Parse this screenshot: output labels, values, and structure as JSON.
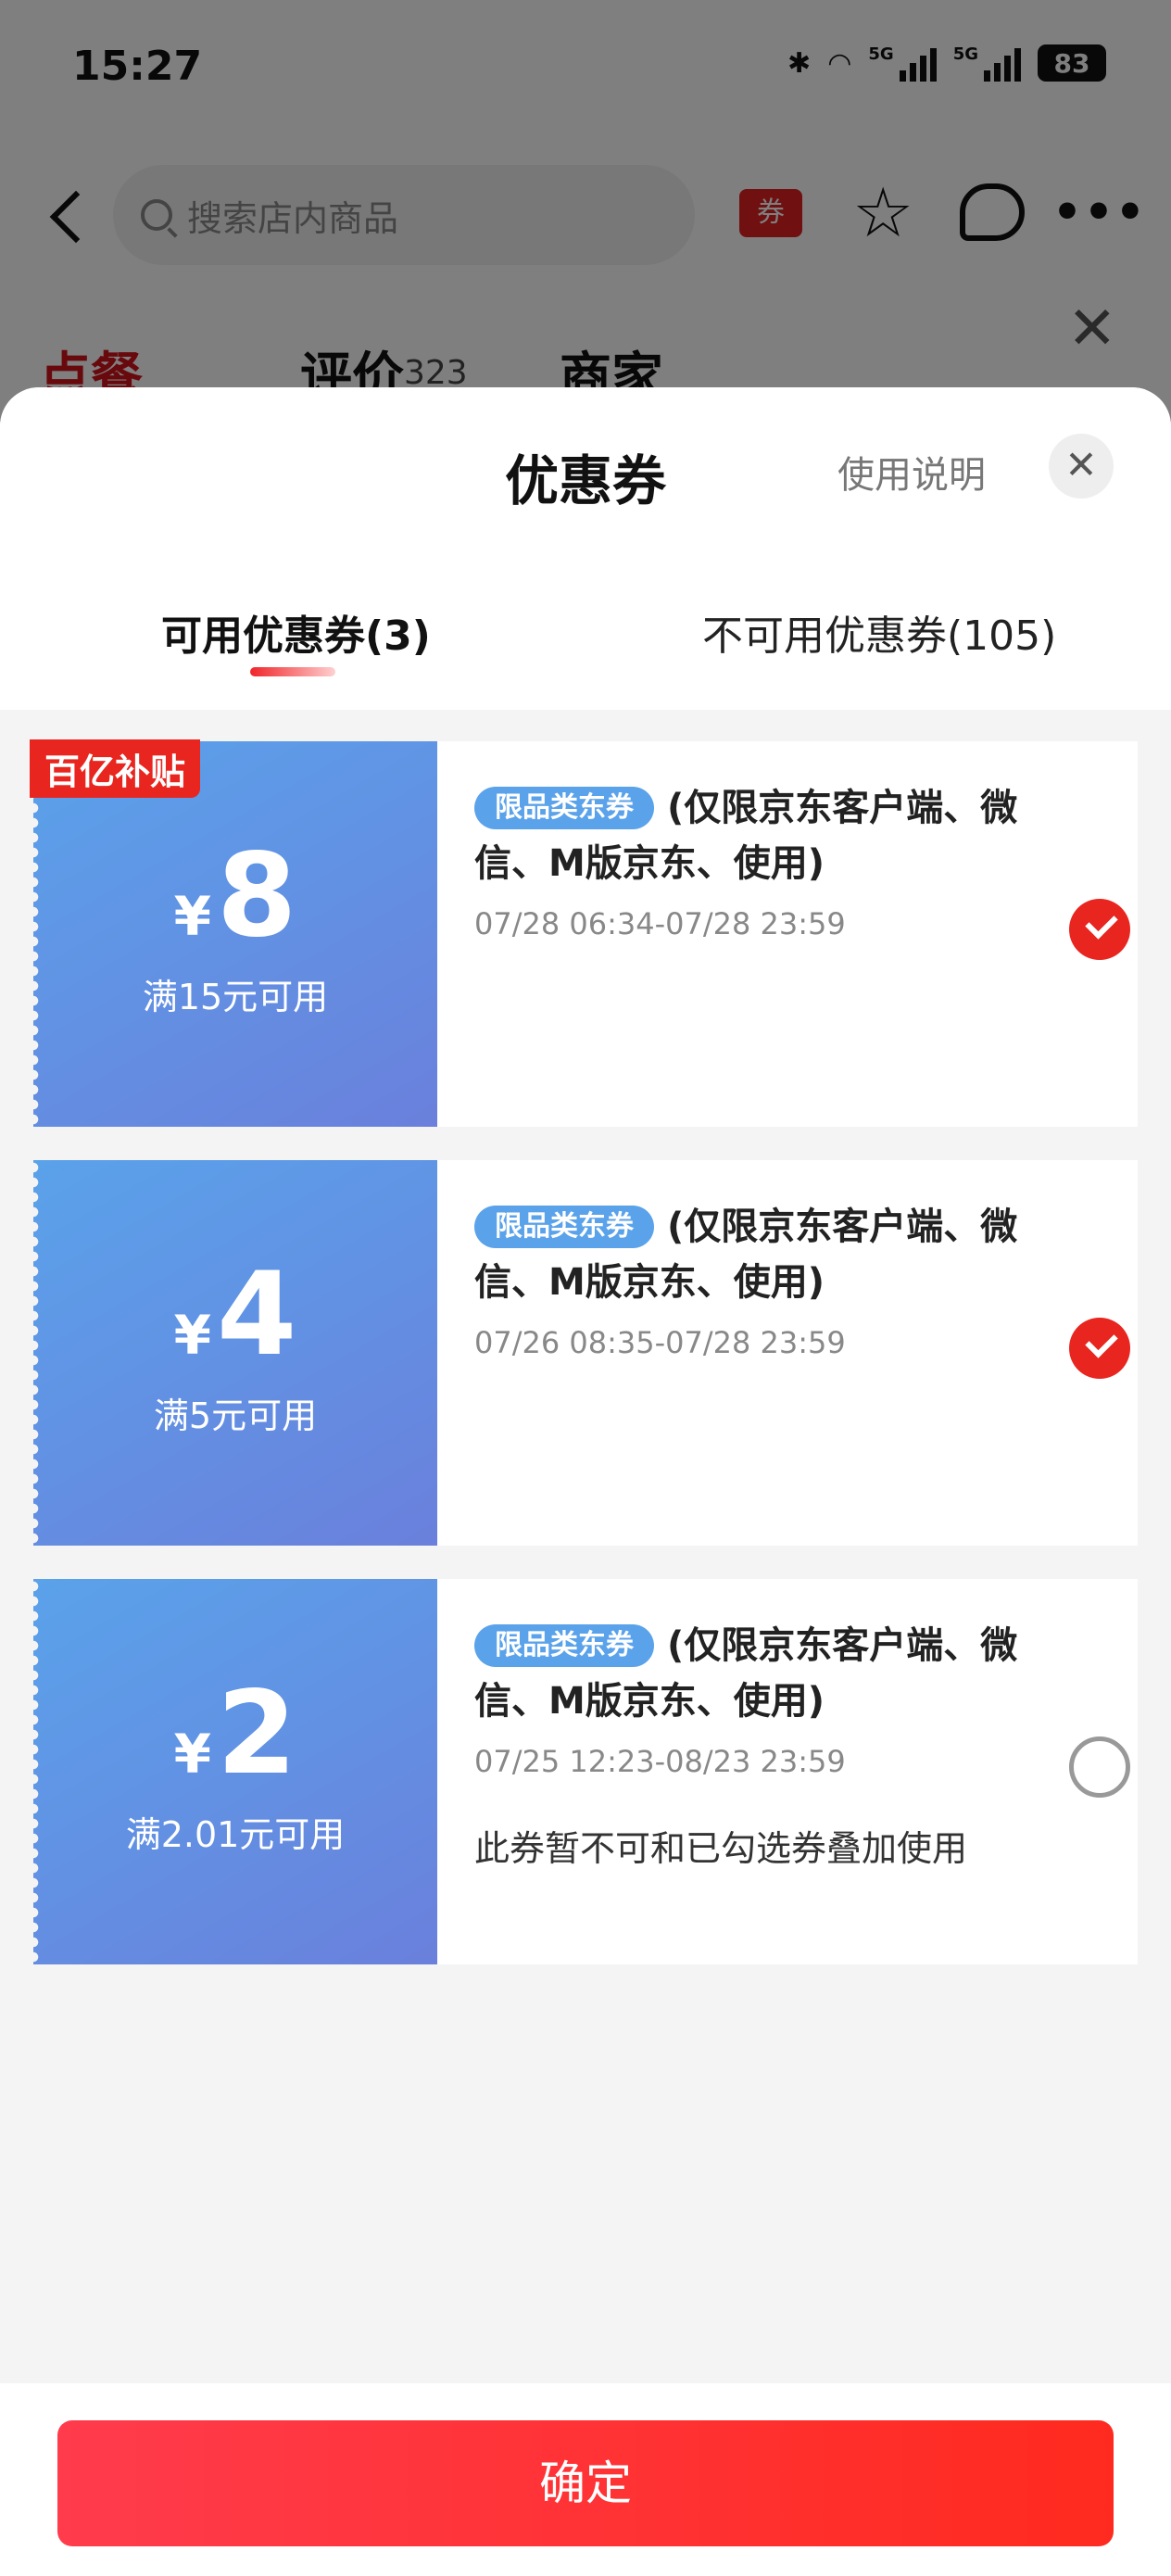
{
  "status": {
    "time": "15:27",
    "signal1": "5G",
    "signal2": "5G",
    "battery": "83"
  },
  "nav": {
    "search_placeholder": "搜索店内商品",
    "coupon_tag": "券"
  },
  "store_tabs": [
    {
      "label": "点餐"
    },
    {
      "label": "评价",
      "count": "323"
    },
    {
      "label": "商家"
    }
  ],
  "sheet": {
    "title": "优惠券",
    "usage_link": "使用说明",
    "tabs": [
      {
        "label": "可用优惠券(3)"
      },
      {
        "label": "不可用优惠券(105)"
      }
    ]
  },
  "coupons": [
    {
      "badge": "百亿补贴",
      "currency": "¥",
      "value": "8",
      "threshold": "满15元可用",
      "tag": "限品类东券",
      "desc": "(仅限京东客户端、微信、M版京东、使用)",
      "time": "07/28 06:34-07/28 23:59",
      "note": "",
      "selected": true
    },
    {
      "badge": "",
      "currency": "¥",
      "value": "4",
      "threshold": "满5元可用",
      "tag": "限品类东券",
      "desc": "(仅限京东客户端、微信、M版京东、使用)",
      "time": "07/26 08:35-07/28 23:59",
      "note": "",
      "selected": true
    },
    {
      "badge": "",
      "currency": "¥",
      "value": "2",
      "threshold": "满2.01元可用",
      "tag": "限品类东券",
      "desc": "(仅限京东客户端、微信、M版京东、使用)",
      "time": "07/25 12:23-08/23 23:59",
      "note": "此券暂不可和已勾选券叠加使用",
      "selected": false
    }
  ],
  "footer": {
    "confirm_label": "确定"
  },
  "colors": {
    "accent": "#e8251f",
    "coupon_blue": "#5aa2ea",
    "confirm_start": "#ff3b4c",
    "confirm_end": "#ff2a1f"
  }
}
